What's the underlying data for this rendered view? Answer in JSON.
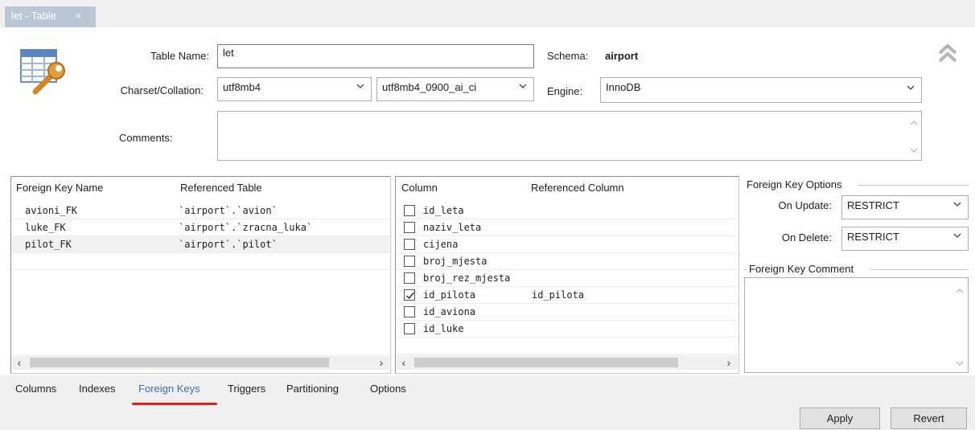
{
  "window": {
    "tab_title": "let - Table",
    "tab_close": "×"
  },
  "header": {
    "table_name_label": "Table Name:",
    "table_name_value": "let",
    "schema_label": "Schema:",
    "schema_value": "airport",
    "charset_label": "Charset/Collation:",
    "charset_value": "utf8mb4",
    "collation_value": "utf8mb4_0900_ai_ci",
    "engine_label": "Engine:",
    "engine_value": "InnoDB",
    "comments_label": "Comments:",
    "comments_value": "",
    "table_icon": "table-wrench-icon",
    "collapse_icon": "double-chevron-up-icon"
  },
  "fk_list": {
    "columns": [
      "Foreign Key Name",
      "Referenced Table"
    ],
    "rows": [
      {
        "name": "avioni_FK",
        "table": "`airport`.`avion`"
      },
      {
        "name": "luke_FK",
        "table": "`airport`.`zracna_luka`"
      },
      {
        "name": "pilot_FK",
        "table": "`airport`.`pilot`"
      }
    ],
    "selected_index": 2
  },
  "col_map": {
    "columns": [
      "Column",
      "Referenced Column"
    ],
    "rows": [
      {
        "column": "id_leta",
        "checked": false,
        "ref": ""
      },
      {
        "column": "naziv_leta",
        "checked": false,
        "ref": ""
      },
      {
        "column": "cijena",
        "checked": false,
        "ref": ""
      },
      {
        "column": "broj_mjesta",
        "checked": false,
        "ref": ""
      },
      {
        "column": "broj_rez_mjesta",
        "checked": false,
        "ref": ""
      },
      {
        "column": "id_pilota",
        "checked": true,
        "ref": "id_pilota"
      },
      {
        "column": "id_aviona",
        "checked": false,
        "ref": ""
      },
      {
        "column": "id_luke",
        "checked": false,
        "ref": ""
      }
    ]
  },
  "fk_options": {
    "title": "Foreign Key Options",
    "on_update_label": "On Update:",
    "on_update_value": "RESTRICT",
    "on_delete_label": "On Delete:",
    "on_delete_value": "RESTRICT",
    "comment_title": "Foreign Key Comment",
    "comment_value": ""
  },
  "bottom_tabs": [
    "Columns",
    "Indexes",
    "Foreign Keys",
    "Triggers",
    "Partitioning",
    "Options"
  ],
  "active_tab": "Foreign Keys",
  "buttons": {
    "apply": "Apply",
    "revert": "Revert"
  },
  "colors": {
    "accent_underline": "#e0201b",
    "active_tab_text": "#3a6fb8",
    "doc_tab_bg": "#b9c7d6"
  }
}
